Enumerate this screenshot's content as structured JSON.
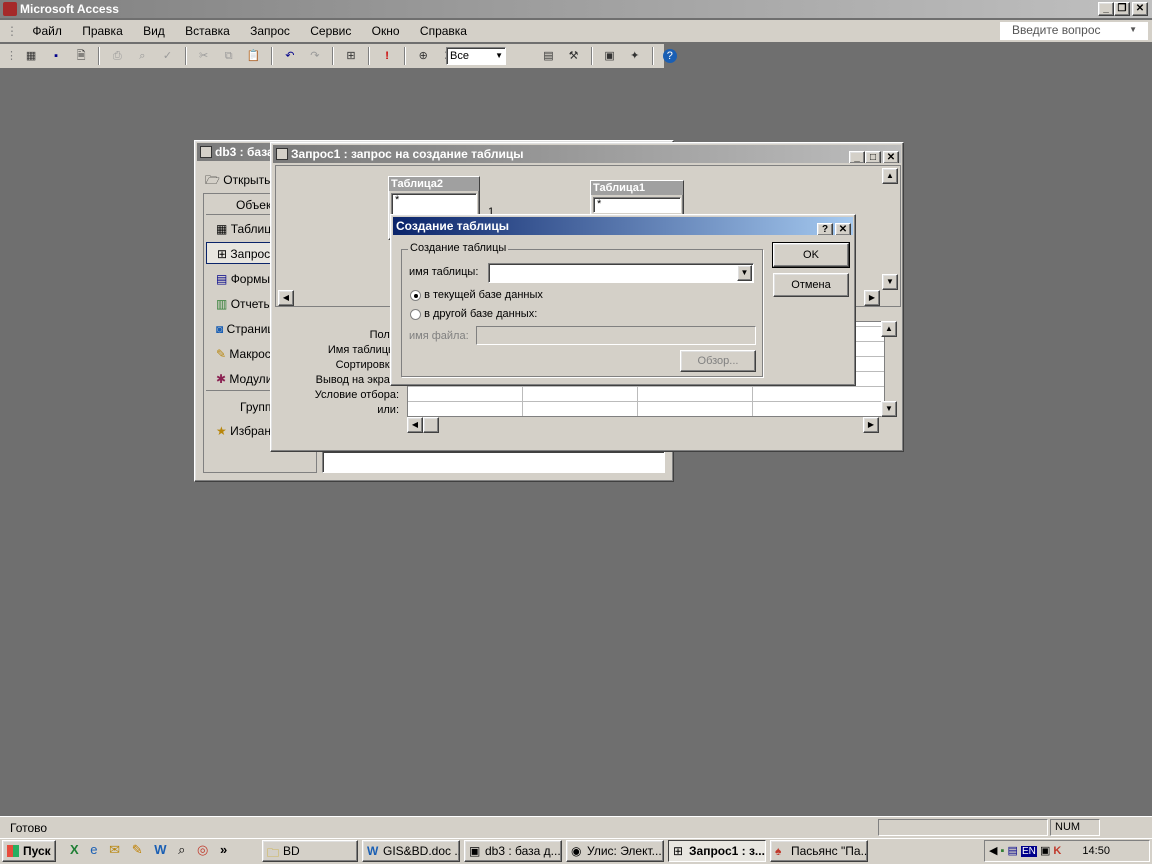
{
  "app": {
    "title": "Microsoft Access",
    "help_placeholder": "Введите вопрос"
  },
  "menu": [
    "Файл",
    "Правка",
    "Вид",
    "Вставка",
    "Запрос",
    "Сервис",
    "Окно",
    "Справка"
  ],
  "toolbar": {
    "view_combo": "Все"
  },
  "db_window": {
    "title": "db3 : база данных",
    "open": "Открыть",
    "objects_label": "Объекты",
    "objects": [
      "Таблицы",
      "Запросы",
      "Формы",
      "Отчеты",
      "Страницы",
      "Макросы",
      "Модули"
    ],
    "groups": "Группы",
    "favorites": "Избранное"
  },
  "query_window": {
    "title": "Запрос1 : запрос на создание таблицы",
    "table_a": "Таблица2",
    "table_b": "Таблица1",
    "star": "*",
    "rel": "1",
    "grid_labels": [
      "Поле:",
      "Имя таблицы:",
      "Сортировка:",
      "Вывод на экран:",
      "Условие отбора:",
      "или:"
    ]
  },
  "dialog": {
    "title": "Создание таблицы",
    "group": "Создание таблицы",
    "table_name_label": "имя таблицы:",
    "table_name_value": "",
    "radio_current": "в текущей базе данных",
    "radio_other": "в другой базе данных:",
    "file_label": "имя файла:",
    "browse": "Обзор...",
    "ok": "OK",
    "cancel": "Отмена"
  },
  "statusbar": {
    "text": "Готово",
    "num": "NUM"
  },
  "taskbar": {
    "start": "Пуск",
    "items": [
      "BD",
      "GIS&BD.doc ...",
      "db3 : база д...",
      "Улис: Элект...",
      "Запрос1 : з...",
      "Пасьянс \"Па..."
    ],
    "lang": "EN",
    "clock": "14:50"
  }
}
